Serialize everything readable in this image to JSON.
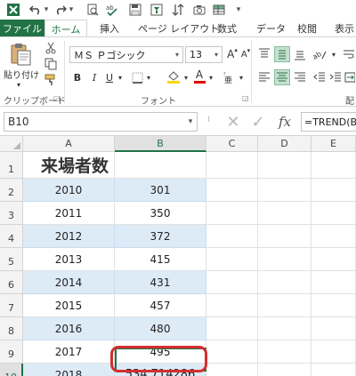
{
  "quick_access": {
    "save_icon": "save-icon",
    "undo_icon": "undo-icon",
    "redo_icon": "redo-icon",
    "customize_icon": "customize-dropdown-icon"
  },
  "tabs": {
    "file": "ファイル",
    "home": "ホーム",
    "insert": "挿入",
    "page_layout": "ページ レイアウト",
    "formulas": "数式",
    "data": "データ",
    "review": "校閲",
    "view": "表示"
  },
  "ribbon": {
    "clipboard": {
      "paste_label": "貼り付け",
      "group_label": "クリップボード"
    },
    "font": {
      "font_name": "ＭＳ Ｐゴシック",
      "font_size": "13",
      "bold": "B",
      "italic": "I",
      "underline": "U",
      "grow": "A",
      "shrink": "A",
      "font_color_letter": "A",
      "group_label": "フォント",
      "highlight_color": "#ffd700",
      "font_color": "#e00000"
    },
    "alignment": {
      "group_label_partial": "配"
    }
  },
  "formula_bar": {
    "name_box": "B10",
    "formula": "=TREND(B",
    "fx": "fx"
  },
  "sheet": {
    "columns": [
      "A",
      "B",
      "C",
      "D",
      "E"
    ],
    "rows": [
      "1",
      "2",
      "3",
      "4",
      "5",
      "6",
      "7",
      "8",
      "9",
      "10"
    ],
    "title": "来場者数",
    "data": [
      {
        "year": "2010",
        "value": "301"
      },
      {
        "year": "2011",
        "value": "350"
      },
      {
        "year": "2012",
        "value": "372"
      },
      {
        "year": "2013",
        "value": "415"
      },
      {
        "year": "2014",
        "value": "431"
      },
      {
        "year": "2015",
        "value": "457"
      },
      {
        "year": "2016",
        "value": "480"
      },
      {
        "year": "2017",
        "value": "495"
      },
      {
        "year": "2018",
        "value": "534.714286"
      }
    ],
    "selected_cell": "B10",
    "band_color": "#ddebf7",
    "accent_color": "#217346",
    "highlight_color": "#d42f2f"
  }
}
